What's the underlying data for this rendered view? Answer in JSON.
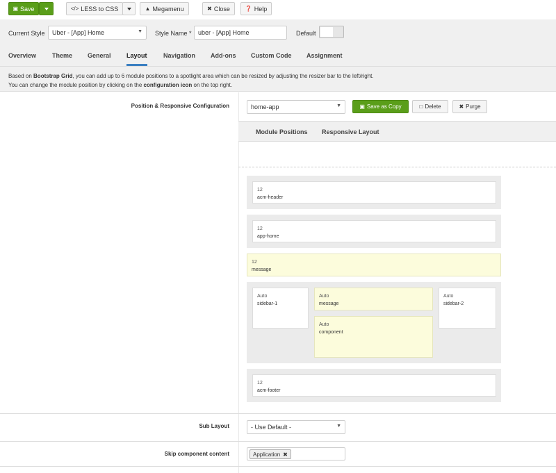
{
  "toolbar": {
    "save_label": "Save",
    "less_label": "LESS to CSS",
    "megamenu_label": "Megamenu",
    "close_label": "Close",
    "help_label": "Help"
  },
  "stylebar": {
    "current_style_label": "Current Style",
    "current_style_value": "Uber - [App] Home",
    "style_name_label": "Style Name *",
    "style_name_value": "uber - [App] Home",
    "default_label": "Default"
  },
  "tabs": [
    "Overview",
    "Theme",
    "General",
    "Layout",
    "Navigation",
    "Add-ons",
    "Custom Code",
    "Assignment"
  ],
  "info": {
    "line1_pre": "Based on ",
    "line1_bold": "Bootstrap Grid",
    "line1_post": ", you can add up to 6 module positions to a spotlight area which can be resized by adjusting the resizer bar to the left/right.",
    "line2_pre": "You can change the module position by clicking on the ",
    "line2_bold": "configuration icon",
    "line2_post": " on the top right."
  },
  "config": {
    "label": "Position & Responsive Configuration",
    "layout_value": "home-app",
    "save_copy_label": "Save as Copy",
    "delete_label": "Delete",
    "purge_label": "Purge",
    "subtabs": [
      "Module Positions",
      "Responsive Layout"
    ]
  },
  "modules": {
    "header": {
      "size": "12",
      "name": "acm-header"
    },
    "apphome": {
      "size": "12",
      "name": "app-home"
    },
    "message": {
      "size": "12",
      "name": "message"
    },
    "sidebar1": {
      "size": "Auto",
      "name": "sidebar-1"
    },
    "message2": {
      "size": "Auto",
      "name": "message"
    },
    "component": {
      "size": "Auto",
      "name": "component"
    },
    "sidebar2": {
      "size": "Auto",
      "name": "sidebar-2"
    },
    "footer": {
      "size": "12",
      "name": "acm-footer"
    }
  },
  "sublayout": {
    "label": "Sub Layout",
    "value": "- Use Default -"
  },
  "skip": {
    "label": "Skip component content",
    "tag": "Application"
  },
  "colors": {
    "accent_green": "#5a9e1a",
    "tab_underline": "#3a7fc1",
    "highlight_yellow": "#fcfcdc"
  }
}
